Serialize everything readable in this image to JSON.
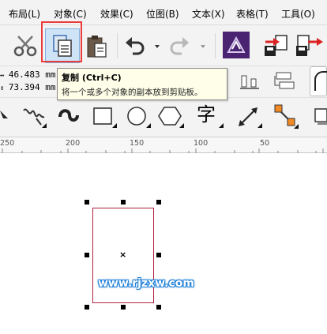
{
  "menubar": {
    "items": [
      "布局(L)",
      "对象(C)",
      "效果(C)",
      "位图(B)",
      "文本(X)",
      "表格(T)",
      "工具(O)"
    ]
  },
  "toolbar": {
    "buttons": [
      "cut-icon",
      "copy-icon",
      "paste-icon",
      "undo-icon",
      "redo-icon",
      "launcher-icon",
      "import-icon",
      "export-icon"
    ],
    "highlight_color": "#ec3b3b"
  },
  "property_bar": {
    "width_value": "46.483 mm",
    "height_value": "73.394 mm"
  },
  "tooltip": {
    "title": "复制 (Ctrl+C)",
    "description": "将一个或多个对象的副本放到剪贴板。"
  },
  "toolbox": {
    "text_tool_glyph": "字"
  },
  "ruler": {
    "labels": [
      "250",
      "200",
      "150",
      "100",
      "50"
    ]
  },
  "canvas": {
    "selection_outline_color": "#b0203a",
    "center_mark": "×",
    "watermark": "www.rjzxw.com"
  }
}
